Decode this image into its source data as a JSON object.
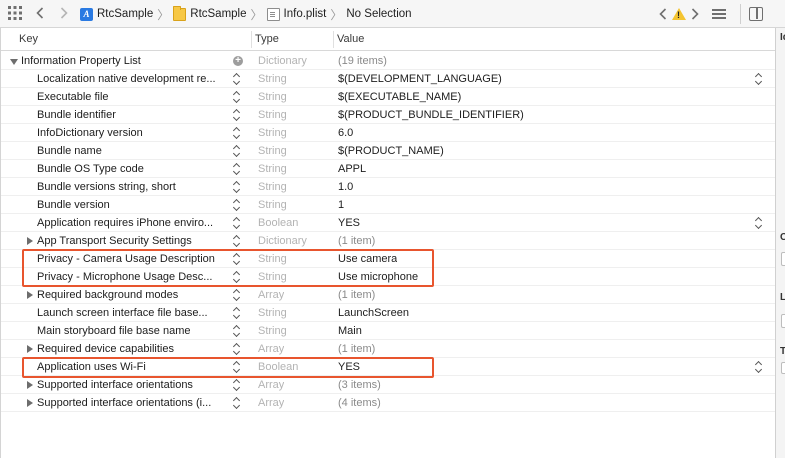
{
  "breadcrumb": {
    "items": [
      "RtcSample",
      "RtcSample",
      "Info.plist",
      "No Selection"
    ]
  },
  "table": {
    "headers": {
      "key": "Key",
      "type": "Type",
      "value": "Value"
    },
    "rows": [
      {
        "key": "Information Property List",
        "type": "Dictionary",
        "value": "(19 items)",
        "level": 0,
        "disclosure": "down",
        "control": "add",
        "value_dim": true
      },
      {
        "key": "Localization native development re...",
        "type": "String",
        "value": "$(DEVELOPMENT_LANGUAGE)",
        "level": 1,
        "disclosure": "none",
        "control": "stepper",
        "value_stepper": true
      },
      {
        "key": "Executable file",
        "type": "String",
        "value": "$(EXECUTABLE_NAME)",
        "level": 1,
        "disclosure": "none",
        "control": "stepper"
      },
      {
        "key": "Bundle identifier",
        "type": "String",
        "value": "$(PRODUCT_BUNDLE_IDENTIFIER)",
        "level": 1,
        "disclosure": "none",
        "control": "stepper"
      },
      {
        "key": "InfoDictionary version",
        "type": "String",
        "value": "6.0",
        "level": 1,
        "disclosure": "none",
        "control": "stepper"
      },
      {
        "key": "Bundle name",
        "type": "String",
        "value": "$(PRODUCT_NAME)",
        "level": 1,
        "disclosure": "none",
        "control": "stepper"
      },
      {
        "key": "Bundle OS Type code",
        "type": "String",
        "value": "APPL",
        "level": 1,
        "disclosure": "none",
        "control": "stepper"
      },
      {
        "key": "Bundle versions string, short",
        "type": "String",
        "value": "1.0",
        "level": 1,
        "disclosure": "none",
        "control": "stepper"
      },
      {
        "key": "Bundle version",
        "type": "String",
        "value": "1",
        "level": 1,
        "disclosure": "none",
        "control": "stepper"
      },
      {
        "key": "Application requires iPhone enviro...",
        "type": "Boolean",
        "value": "YES",
        "level": 1,
        "disclosure": "none",
        "control": "stepper",
        "value_stepper": true
      },
      {
        "key": "App Transport Security Settings",
        "type": "Dictionary",
        "value": "(1 item)",
        "level": 1,
        "disclosure": "right",
        "control": "stepper",
        "value_dim": true
      },
      {
        "key": "Privacy - Camera Usage Description",
        "type": "String",
        "value": "Use camera",
        "level": 1,
        "disclosure": "none",
        "control": "stepper"
      },
      {
        "key": "Privacy - Microphone Usage Desc...",
        "type": "String",
        "value": "Use microphone",
        "level": 1,
        "disclosure": "none",
        "control": "stepper"
      },
      {
        "key": "Required background modes",
        "type": "Array",
        "value": "(1 item)",
        "level": 1,
        "disclosure": "right",
        "control": "stepper",
        "value_dim": true
      },
      {
        "key": "Launch screen interface file base...",
        "type": "String",
        "value": "LaunchScreen",
        "level": 1,
        "disclosure": "none",
        "control": "stepper"
      },
      {
        "key": "Main storyboard file base name",
        "type": "String",
        "value": "Main",
        "level": 1,
        "disclosure": "none",
        "control": "stepper"
      },
      {
        "key": "Required device capabilities",
        "type": "Array",
        "value": "(1 item)",
        "level": 1,
        "disclosure": "right",
        "control": "stepper",
        "value_dim": true
      },
      {
        "key": "Application uses Wi-Fi",
        "type": "Boolean",
        "value": "YES",
        "level": 1,
        "disclosure": "none",
        "control": "stepper",
        "value_stepper": true
      },
      {
        "key": "Supported interface orientations",
        "type": "Array",
        "value": "(3 items)",
        "level": 1,
        "disclosure": "right",
        "control": "stepper",
        "value_dim": true
      },
      {
        "key": "Supported interface orientations (i...",
        "type": "Array",
        "value": "(4 items)",
        "level": 1,
        "disclosure": "right",
        "control": "stepper",
        "value_dim": true
      }
    ]
  },
  "inspector": {
    "labels": [
      "Id",
      "C",
      "L",
      "T"
    ]
  },
  "colors": {
    "highlight": "#e8552e",
    "type_text": "#b3b3b3",
    "warning": "#f4c430"
  }
}
